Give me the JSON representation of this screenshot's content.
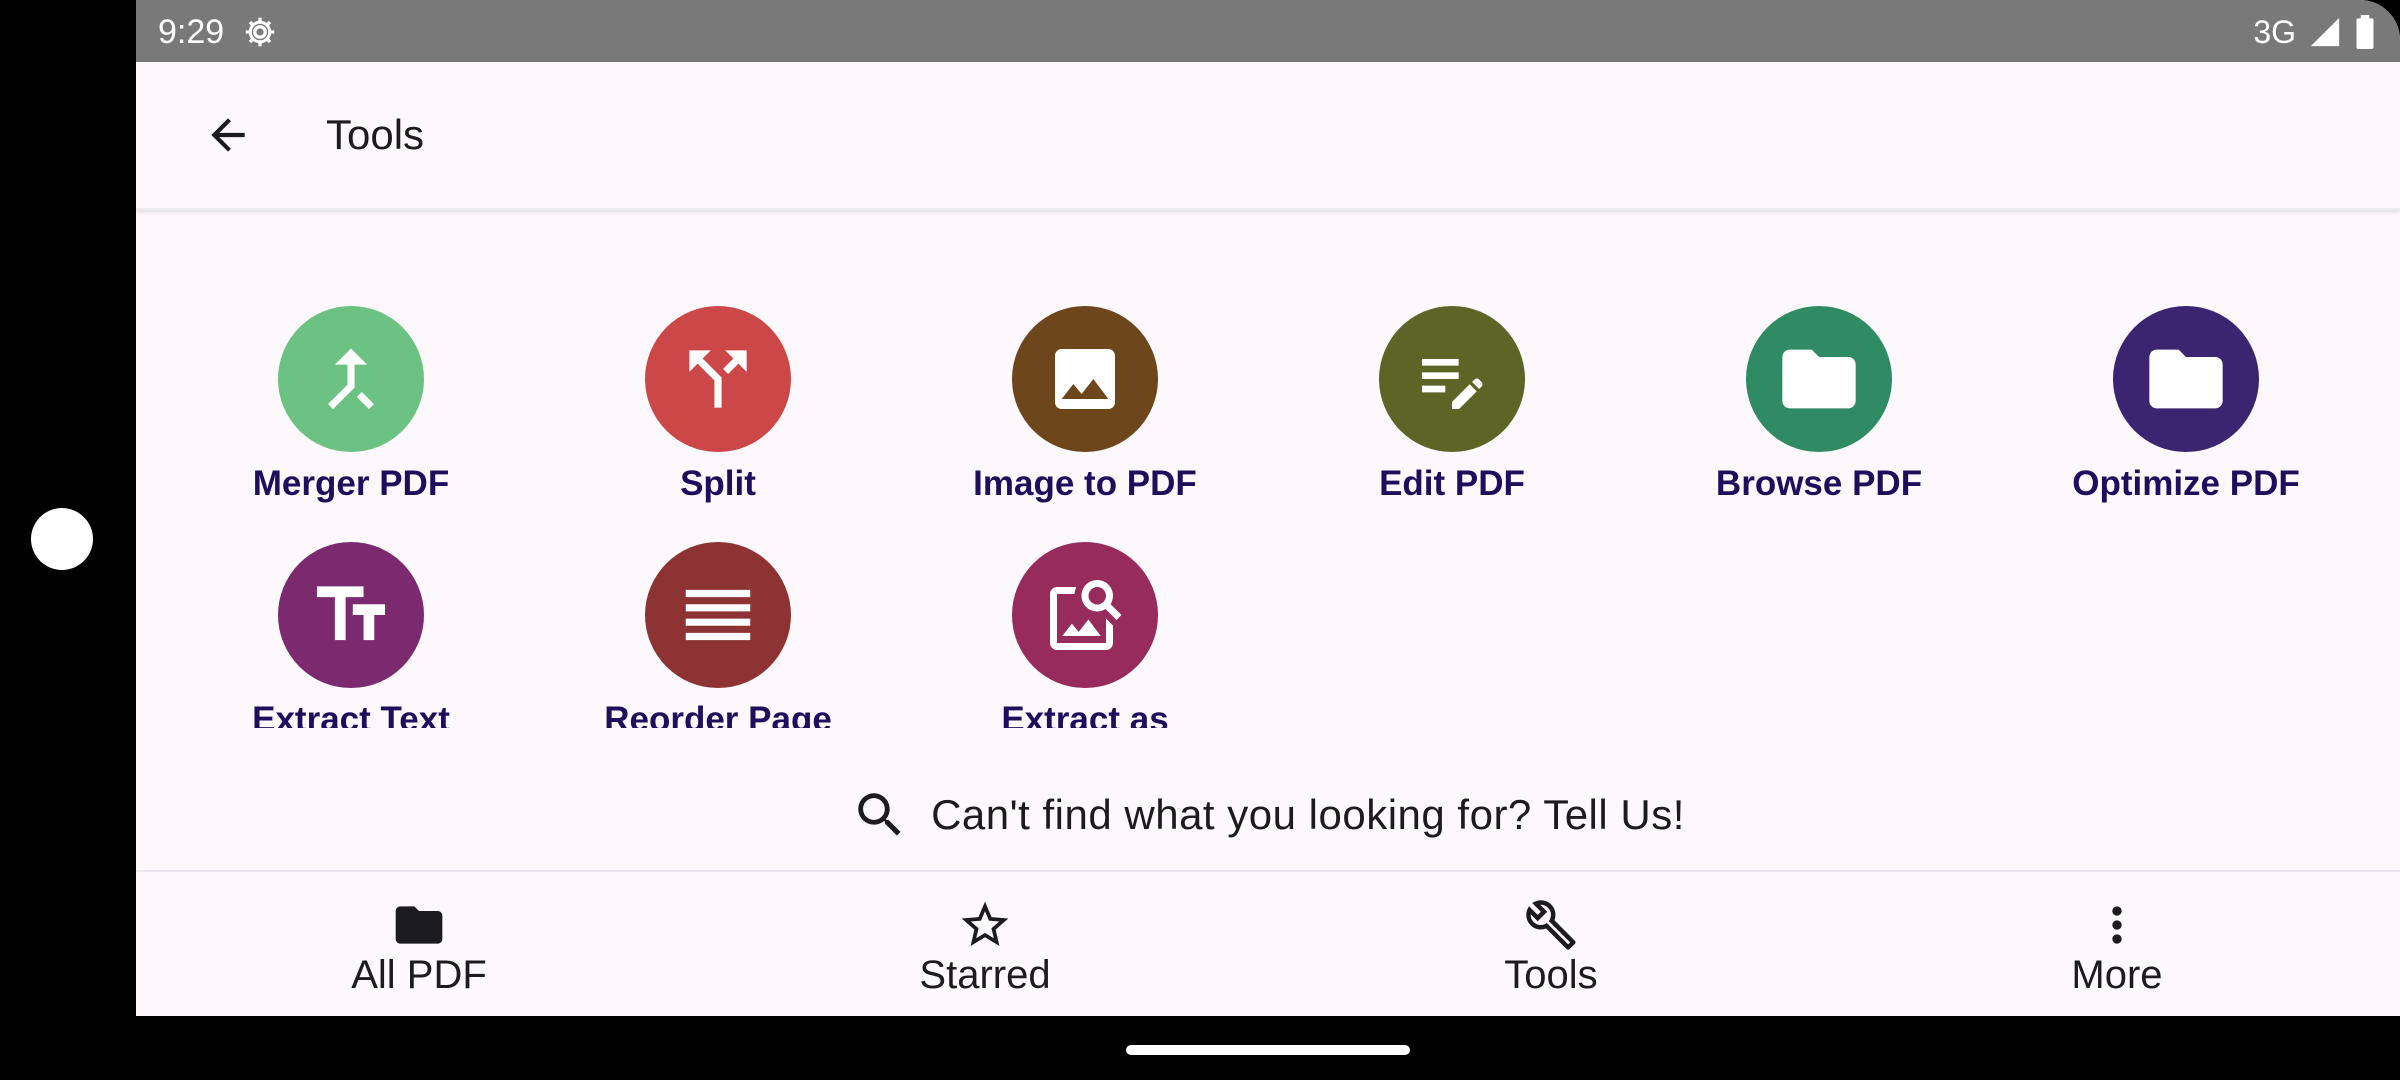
{
  "status_bar": {
    "time": "9:29",
    "network": "3G",
    "icons": [
      "gear-icon",
      "signal-icon",
      "battery-icon"
    ]
  },
  "app_bar": {
    "title": "Tools",
    "back_icon": "arrow-left-icon"
  },
  "tools": [
    {
      "label": "Merger PDF",
      "icon": "merge-icon",
      "color": "#6bc283"
    },
    {
      "label": "Split",
      "icon": "split-icon",
      "color": "#cc4747"
    },
    {
      "label": "Image to PDF",
      "icon": "image-icon",
      "color": "#6e461b"
    },
    {
      "label": "Edit PDF",
      "icon": "edit-note-icon",
      "color": "#5c6526"
    },
    {
      "label": "Browse PDF",
      "icon": "folder-icon",
      "color": "#2e8b63"
    },
    {
      "label": "Optimize PDF",
      "icon": "folder-icon",
      "color": "#3b2470"
    },
    {
      "label": "Extract Text",
      "icon": "text-fields-icon",
      "color": "#7b2a6f"
    },
    {
      "label": "Reorder Page",
      "icon": "reorder-icon",
      "color": "#8e3333"
    },
    {
      "label": "Extract as",
      "icon": "image-search-icon",
      "color": "#962b5c"
    }
  ],
  "feedback": {
    "text": "Can't find what you looking for? Tell Us!",
    "icon": "search-icon"
  },
  "bottom_nav": [
    {
      "label": "All PDF",
      "icon": "folder-icon"
    },
    {
      "label": "Starred",
      "icon": "star-outline-icon"
    },
    {
      "label": "Tools",
      "icon": "wrench-icon"
    },
    {
      "label": "More",
      "icon": "more-vert-icon"
    }
  ],
  "colors": {
    "label_text": "#1d0f5c",
    "background": "#fcf8fc",
    "status_bar": "#797979"
  }
}
